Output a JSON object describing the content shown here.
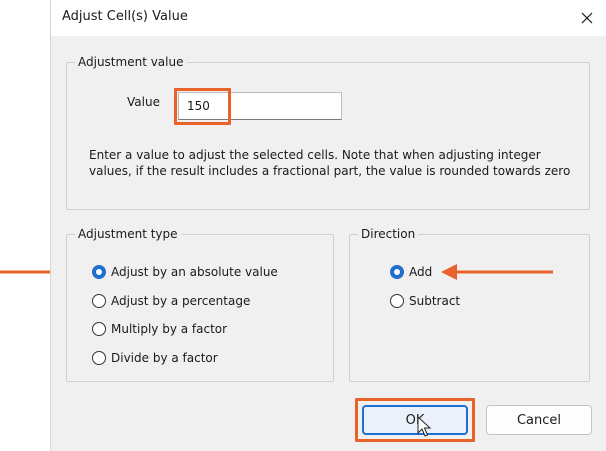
{
  "window": {
    "title": "Adjust Cell(s) Value",
    "close_icon": "close-icon"
  },
  "adjustment_value": {
    "group_label": "Adjustment value",
    "value_label": "Value",
    "value": "150",
    "description": "Enter a value to adjust the selected cells. Note that when adjusting integer values, if the result includes a fractional part, the value is rounded towards zero"
  },
  "adjustment_type": {
    "group_label": "Adjustment type",
    "options": [
      {
        "label": "Adjust by an absolute value",
        "checked": true
      },
      {
        "label": "Adjust by a percentage",
        "checked": false
      },
      {
        "label": "Multiply by a factor",
        "checked": false
      },
      {
        "label": "Divide by a factor",
        "checked": false
      }
    ]
  },
  "direction": {
    "group_label": "Direction",
    "options": [
      {
        "label": "Add",
        "checked": true
      },
      {
        "label": "Subtract",
        "checked": false
      }
    ]
  },
  "buttons": {
    "ok_label": "OK",
    "cancel_label": "Cancel"
  },
  "colors": {
    "highlight": "#e8622a",
    "accent": "#1f6fd1"
  }
}
